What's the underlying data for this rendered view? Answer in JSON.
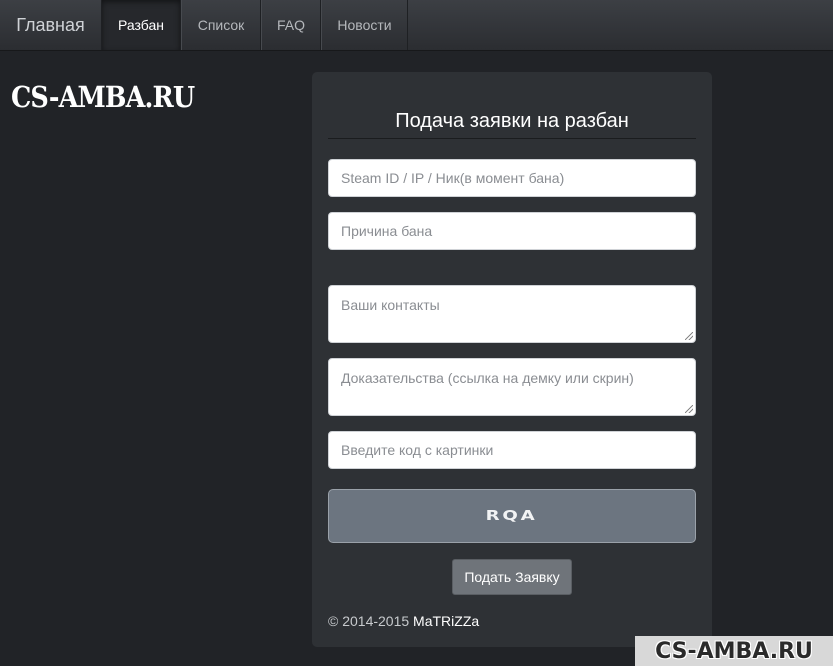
{
  "navbar": {
    "brand": "Главная",
    "items": [
      {
        "label": "Разбан",
        "active": true
      },
      {
        "label": "Список",
        "active": false
      },
      {
        "label": "FAQ",
        "active": false
      },
      {
        "label": "Новости",
        "active": false
      }
    ]
  },
  "logo": "CS-AMBA.RU",
  "form": {
    "title": "Подача заявки на разбан",
    "steam_placeholder": "Steam ID / IP / Ник(в момент бана)",
    "reason_placeholder": "Причина бана",
    "contacts_placeholder": "Ваши контакты",
    "proof_placeholder": "Доказательства (ссылка на демку или скрин)",
    "captcha_placeholder": "Введите код с картинки",
    "captcha_code": "RQA",
    "submit_label": "Подать Заявку"
  },
  "footer": {
    "copyright": "© 2014-2015",
    "author": "MaTRiZZa"
  },
  "watermark": "CS-AMBA.RU",
  "colors": {
    "background": "#212327",
    "panel": "#2e3135",
    "captcha_bg": "#6c7580",
    "button_bg": "#6f747a"
  }
}
